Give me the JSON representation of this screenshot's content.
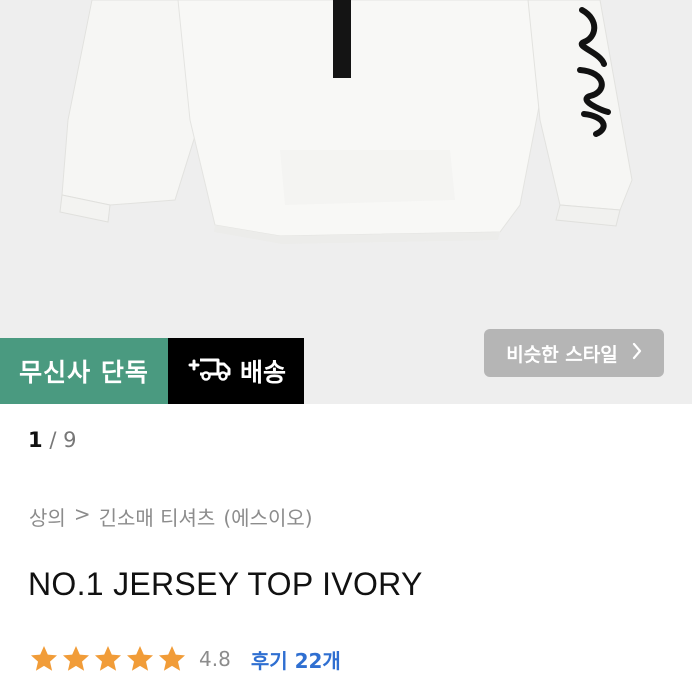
{
  "badges": {
    "exclusive": "무신사 단독",
    "delivery": "배송"
  },
  "similar_style": {
    "label": "비슷한 스타일",
    "icon": "chevron-right-icon"
  },
  "pager": {
    "current": "1",
    "separator": "/",
    "total": "9"
  },
  "breadcrumb": {
    "category": "상의",
    "separator": ">",
    "subcategory": "긴소매 티셔츠",
    "brand": "(에스이오)"
  },
  "product": {
    "title": "NO.1 JERSEY TOP IVORY",
    "rating": 4.8,
    "rating_label": "4.8",
    "reviews_label": "후기 22개"
  },
  "colors": {
    "exclusive_bg": "#4a9a80",
    "delivery_bg": "#000000",
    "star": "#f19c38",
    "reviews_link": "#2f6fd1"
  },
  "icons": {
    "delivery": "plus-truck-icon",
    "star": "star-icon"
  }
}
